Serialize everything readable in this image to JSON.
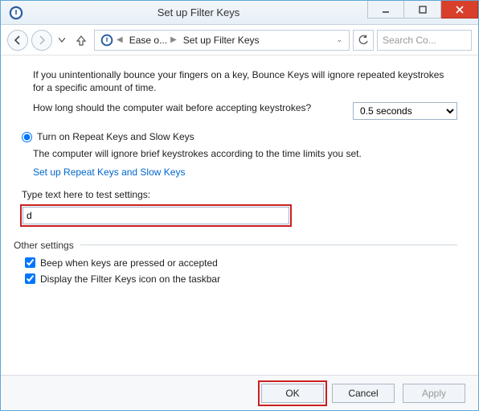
{
  "window": {
    "title": "Set up Filter Keys"
  },
  "nav": {
    "crumb1": "Ease o...",
    "crumb2": "Set up Filter Keys",
    "search_placeholder": "Search Co..."
  },
  "body": {
    "bounce_intro": "If you unintentionally bounce your fingers on a key, Bounce Keys will ignore repeated keystrokes for a specific amount of time.",
    "wait_question": "How long should the computer wait before accepting keystrokes?",
    "wait_duration": "0.5 seconds",
    "radio_repeat_slow": "Turn on Repeat Keys and Slow Keys",
    "repeat_slow_desc": "The computer will ignore brief keystrokes according to the time limits you set.",
    "setup_link": "Set up Repeat Keys and Slow Keys",
    "test_label": "Type text here to test settings:",
    "test_value": "d",
    "other_settings": "Other settings",
    "beep_label": "Beep when keys are pressed or accepted",
    "display_icon_label": "Display the Filter Keys icon on the taskbar"
  },
  "footer": {
    "ok": "OK",
    "cancel": "Cancel",
    "apply": "Apply"
  }
}
